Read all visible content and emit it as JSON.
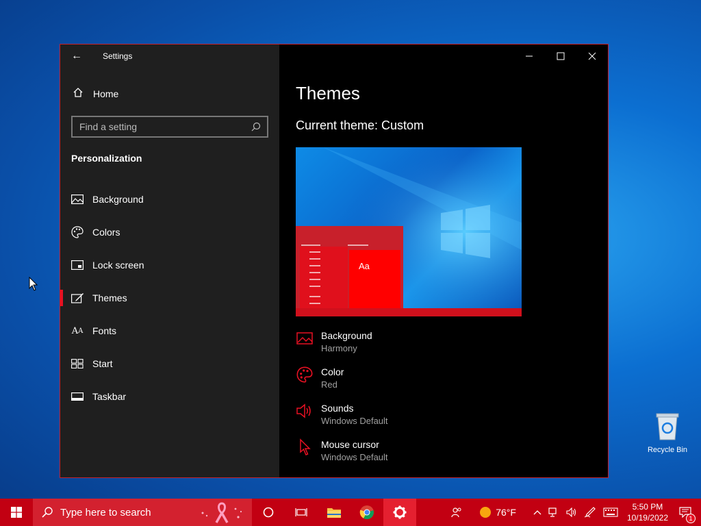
{
  "window": {
    "app_title": "Settings",
    "back_glyph": "←",
    "controls": {
      "minimize": "—",
      "maximize": "☐",
      "close": "✕"
    }
  },
  "sidebar": {
    "home_label": "Home",
    "search_placeholder": "Find a setting",
    "section_title": "Personalization",
    "items": [
      {
        "label": "Background",
        "icon": "picture-icon"
      },
      {
        "label": "Colors",
        "icon": "palette-icon"
      },
      {
        "label": "Lock screen",
        "icon": "lock-screen-icon"
      },
      {
        "label": "Themes",
        "icon": "brush-icon",
        "active": true
      },
      {
        "label": "Fonts",
        "icon": "font-icon"
      },
      {
        "label": "Start",
        "icon": "start-grid-icon"
      },
      {
        "label": "Taskbar",
        "icon": "taskbar-icon"
      }
    ]
  },
  "main": {
    "page_title": "Themes",
    "current_theme": "Current theme: Custom",
    "preview_sample_text": "Aa",
    "properties": [
      {
        "title": "Background",
        "value": "Harmony",
        "icon": "picture-icon"
      },
      {
        "title": "Color",
        "value": "Red",
        "icon": "palette-icon"
      },
      {
        "title": "Sounds",
        "value": "Windows Default",
        "icon": "speaker-icon"
      },
      {
        "title": "Mouse cursor",
        "value": "Windows Default",
        "icon": "cursor-icon"
      }
    ]
  },
  "desktop": {
    "recycle_bin_label": "Recycle Bin"
  },
  "taskbar": {
    "search_placeholder": "Type here to search",
    "weather": "76°F",
    "time": "5:50 PM",
    "date": "10/19/2022",
    "notification_count": "1"
  },
  "colors": {
    "accent": "#e81123",
    "taskbar": "#c20012",
    "sidebar_bg": "#1f1f1f",
    "content_bg": "#000000"
  }
}
